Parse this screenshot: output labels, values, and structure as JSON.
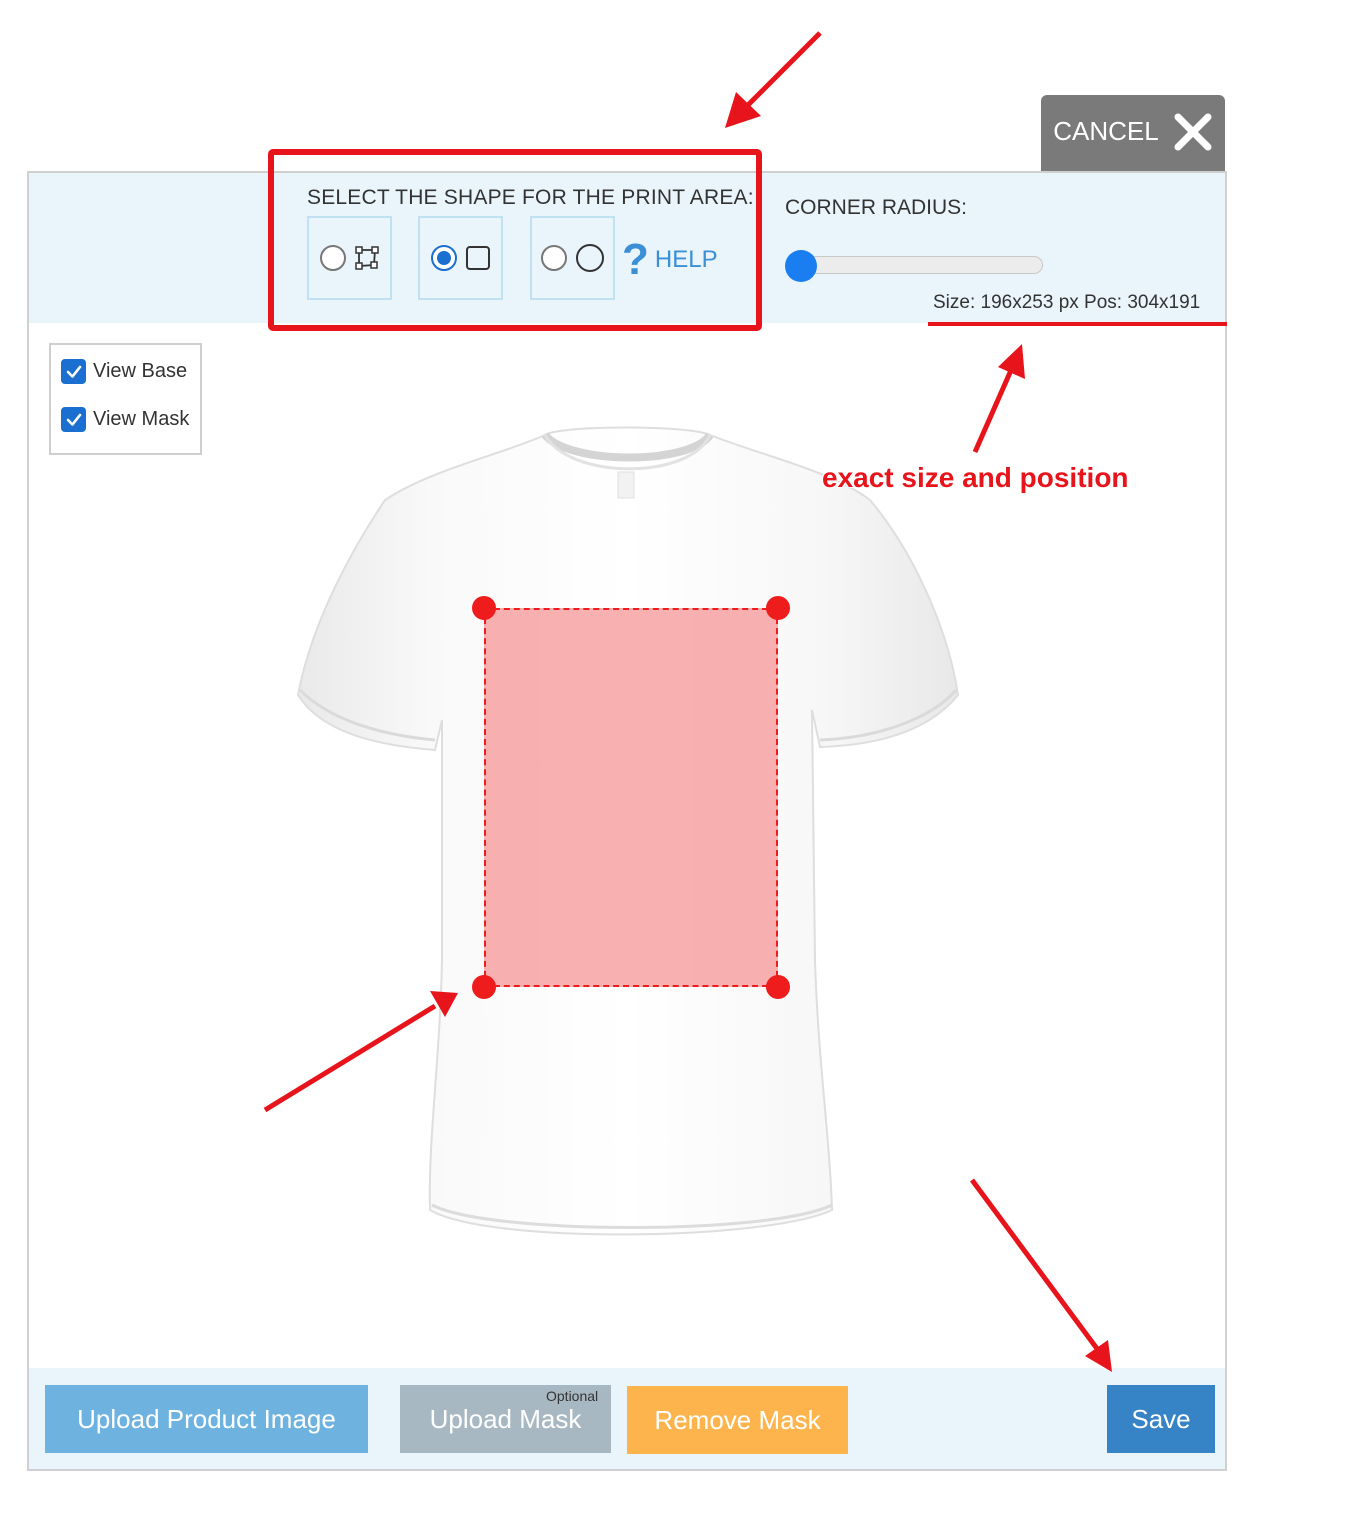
{
  "cancel": {
    "label": "CANCEL",
    "icon": "close-icon"
  },
  "shape_selector": {
    "title": "SELECT THE SHAPE FOR THE PRINT AREA:",
    "options": [
      {
        "icon": "polygon-shape-icon",
        "selected": false
      },
      {
        "icon": "square-shape-icon",
        "selected": true
      },
      {
        "icon": "circle-shape-icon",
        "selected": false
      }
    ],
    "help_label": "HELP",
    "help_icon": "question-mark-icon"
  },
  "corner_radius": {
    "title": "CORNER RADIUS:",
    "value": 0
  },
  "size_pos": "Size: 196x253 px Pos: 304x191",
  "view": {
    "base_label": "View Base",
    "base_checked": true,
    "mask_label": "View Mask",
    "mask_checked": true
  },
  "buttons": {
    "upload_product": "Upload Product Image",
    "upload_mask": "Upload Mask",
    "upload_mask_note": "Optional",
    "remove_mask": "Remove Mask",
    "save": "Save"
  },
  "annotation": "exact size and position",
  "colors": {
    "accent": "#1a6fd1",
    "annotation_red": "#e8141c",
    "mask_fill": "#f69696",
    "save": "#3683c6",
    "remove": "#fdb44c"
  }
}
